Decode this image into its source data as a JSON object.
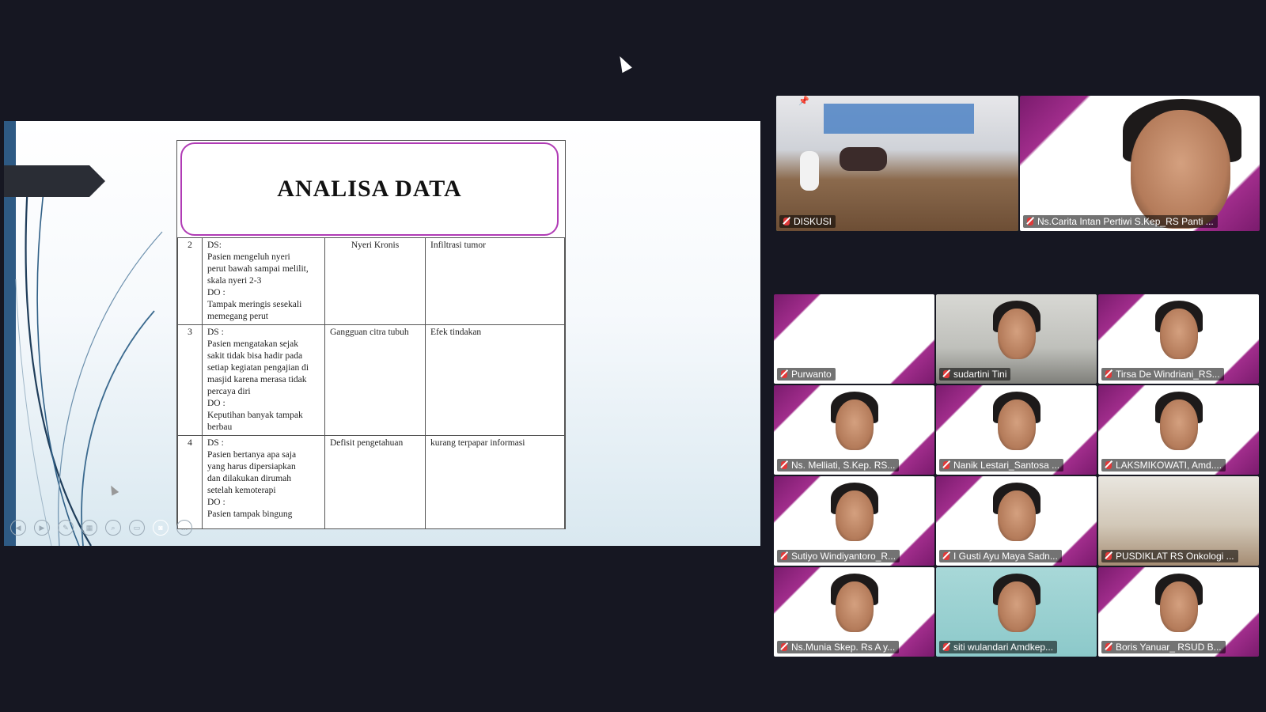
{
  "slide": {
    "title": "ANALISA DATA",
    "rows": [
      {
        "no": "2",
        "ds": [
          "DS:",
          "Pasien mengeluh nyeri",
          "perut bawah sampai melilit,",
          "skala nyeri 2-3",
          "DO :",
          "Tampak meringis sesekali",
          "memegang perut"
        ],
        "diagnosis": "Nyeri Kronis",
        "etiologi": "Infiltrasi tumor"
      },
      {
        "no": "3",
        "ds": [
          "DS :",
          "Pasien mengatakan sejak",
          "sakit tidak bisa hadir pada",
          "setiap kegiatan pengajian di",
          "masjid karena merasa tidak",
          "percaya diri",
          "DO :",
          "Keputihan banyak tampak",
          "berbau"
        ],
        "diagnosis": "Gangguan citra tubuh",
        "etiologi": "Efek tindakan"
      },
      {
        "no": "4",
        "ds": [
          "DS :",
          "Pasien bertanya apa saja",
          "yang harus dipersiapkan",
          "dan dilakukan dirumah",
          "setelah kemoterapi",
          "DO :",
          "Pasien tampak bingung"
        ],
        "diagnosis": "Defisit pengetahuan",
        "etiologi": "kurang terpapar informasi"
      }
    ]
  },
  "pinned": [
    {
      "name": "DISKUSI"
    },
    {
      "name": "Ns.Carita Intan Pertiwi S.Kep_RS Panti ..."
    }
  ],
  "participants": [
    {
      "name": "Purwanto"
    },
    {
      "name": "sudartini Tini"
    },
    {
      "name": "Tirsa De Windriani_RS..."
    },
    {
      "name": "Ns. Melliati, S.Kep. RS..."
    },
    {
      "name": "Nanik Lestari_Santosa ..."
    },
    {
      "name": "LAKSMIKOWATI, Amd...."
    },
    {
      "name": "Sutiyo Windiyantoro_R..."
    },
    {
      "name": "I Gusti Ayu Maya Sadn..."
    },
    {
      "name": "PUSDIKLAT RS Onkologi ..."
    },
    {
      "name": "Ns.Munia Skep. Rs A y..."
    },
    {
      "name": "siti wulandari Amdkep..."
    },
    {
      "name": "Boris Yanuar_ RSUD B..."
    }
  ],
  "colors": {
    "background": "#161722",
    "brand": "#a12d8c",
    "active_speaker": "#3ad06a",
    "muted": "#e03a3a"
  },
  "icons": [
    "mouse-cursor-icon",
    "mic-muted-icon",
    "pin-icon",
    "video-control-icon"
  ]
}
